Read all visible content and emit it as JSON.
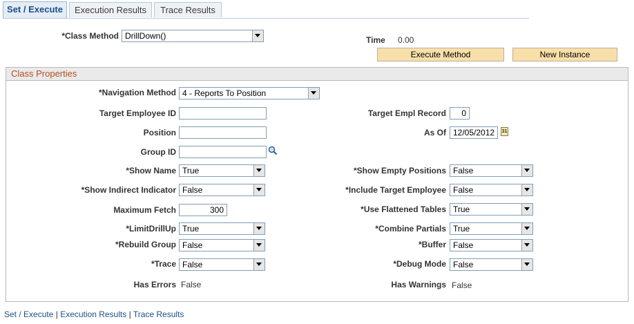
{
  "tabs": [
    {
      "label": "Set / Execute",
      "active": true
    },
    {
      "label": "Execution Results",
      "active": false
    },
    {
      "label": "Trace Results",
      "active": false
    }
  ],
  "class_method": {
    "label": "*Class Method",
    "value": "DrillDown()"
  },
  "time": {
    "label": "Time",
    "value": "0.00"
  },
  "buttons": {
    "execute": "Execute Method",
    "new_instance": "New Instance"
  },
  "panel": {
    "title": "Class Properties",
    "navigation_method": {
      "label": "*Navigation Method",
      "value": "4 - Reports To Position"
    },
    "target_employee_id": {
      "label": "Target Employee ID",
      "value": ""
    },
    "target_empl_record": {
      "label": "Target Empl Record",
      "value": "0"
    },
    "position": {
      "label": "Position",
      "value": ""
    },
    "as_of": {
      "label": "As Of",
      "value": "12/05/2012",
      "calendar_icon_text": "31"
    },
    "group_id": {
      "label": "Group ID",
      "value": ""
    },
    "show_name": {
      "label": "*Show Name",
      "value": "True"
    },
    "show_empty_positions": {
      "label": "*Show Empty Positions",
      "value": "False"
    },
    "show_indirect_indicator": {
      "label": "*Show Indirect Indicator",
      "value": "False"
    },
    "include_target_employee": {
      "label": "*Include Target Employee",
      "value": "False"
    },
    "maximum_fetch": {
      "label": "Maximum Fetch",
      "value": "300"
    },
    "use_flattened_tables": {
      "label": "*Use Flattened Tables",
      "value": "True"
    },
    "limit_drill_up": {
      "label": "*LimitDrillUp",
      "value": "True"
    },
    "combine_partials": {
      "label": "*Combine Partials",
      "value": "True"
    },
    "rebuild_group": {
      "label": "*Rebuild Group",
      "value": "False"
    },
    "buffer": {
      "label": "*Buffer",
      "value": "False"
    },
    "trace": {
      "label": "*Trace",
      "value": "False"
    },
    "debug_mode": {
      "label": "*Debug Mode",
      "value": "False"
    },
    "has_errors": {
      "label": "Has Errors",
      "value": "False"
    },
    "has_warnings": {
      "label": "Has Warnings",
      "value": "False"
    }
  },
  "footer": {
    "link1": "Set / Execute",
    "link2": "Execution Results",
    "link3": "Trace Results",
    "separator": "|"
  }
}
